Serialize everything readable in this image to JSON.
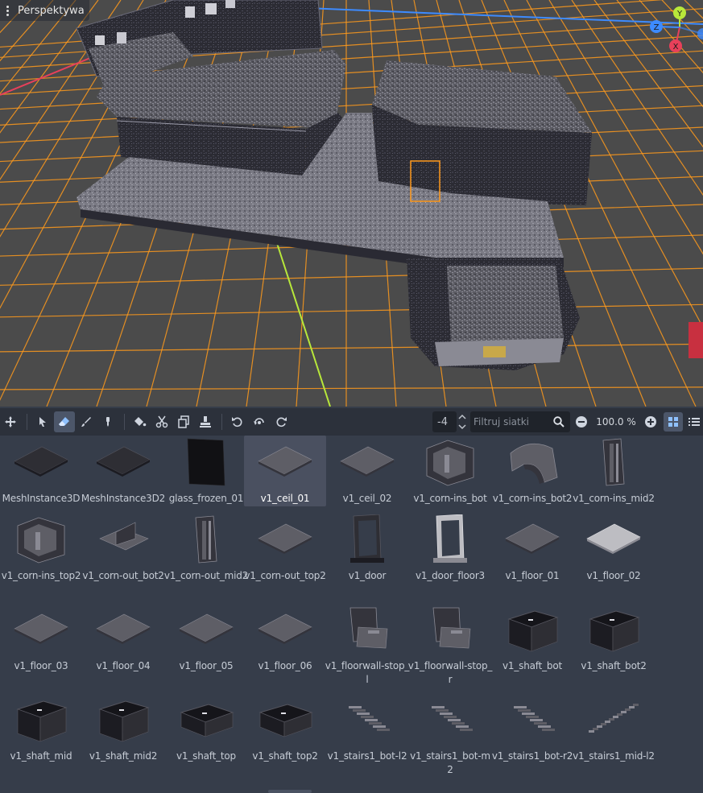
{
  "viewport": {
    "mode_label": "Perspektywa",
    "gizmo": {
      "y_label": "Y",
      "z_label": "Z",
      "x_label": "X"
    },
    "colors": {
      "grid": "#ff9a1c",
      "x_axis": "#e8405a",
      "z_axis": "#3d8bff",
      "y_axis": "#b8e83a"
    }
  },
  "toolbar": {
    "icons": [
      "transform-icon",
      "select-icon",
      "erase-icon",
      "paint-icon",
      "pick-icon",
      "fill-icon",
      "cut-icon",
      "duplicate-icon",
      "place-icon",
      "rotate-left-icon",
      "rotate-icon",
      "rotate-right-icon"
    ],
    "floor_value": "-4",
    "filter_placeholder": "Filtruj siatki",
    "zoom_value": "100.0 %"
  },
  "meshes": [
    {
      "name": "MeshInstance3D",
      "shape": "plate",
      "tone": "dark"
    },
    {
      "name": "MeshInstance3D2",
      "shape": "plate",
      "tone": "dark"
    },
    {
      "name": "glass_frozen_01",
      "shape": "panel",
      "tone": "black"
    },
    {
      "name": "v1_ceil_01",
      "shape": "plate",
      "tone": "mid",
      "selected": true
    },
    {
      "name": "v1_ceil_02",
      "shape": "plate",
      "tone": "mid"
    },
    {
      "name": "v1_corn-ins_bot",
      "shape": "corner",
      "tone": "mid"
    },
    {
      "name": "v1_corn-ins_bot2",
      "shape": "arch",
      "tone": "mid"
    },
    {
      "name": "v1_corn-ins_mid2",
      "shape": "pillar",
      "tone": "mid"
    },
    {
      "name": "v1_corn-ins_top2",
      "shape": "corner",
      "tone": "mid"
    },
    {
      "name": "v1_corn-out_bot2",
      "shape": "ledge",
      "tone": "mid"
    },
    {
      "name": "v1_corn-out_mid2",
      "shape": "pillar",
      "tone": "mid"
    },
    {
      "name": "v1_corn-out_top2",
      "shape": "plate",
      "tone": "mid"
    },
    {
      "name": "v1_door",
      "shape": "door",
      "tone": "dark"
    },
    {
      "name": "v1_door_floor3",
      "shape": "door",
      "tone": "light"
    },
    {
      "name": "v1_floor_01",
      "shape": "plate",
      "tone": "mid"
    },
    {
      "name": "v1_floor_02",
      "shape": "plate",
      "tone": "light"
    },
    {
      "name": "v1_floor_03",
      "shape": "plate",
      "tone": "mid"
    },
    {
      "name": "v1_floor_04",
      "shape": "plate",
      "tone": "mid"
    },
    {
      "name": "v1_floor_05",
      "shape": "plate",
      "tone": "mid"
    },
    {
      "name": "v1_floor_06",
      "shape": "plate",
      "tone": "mid"
    },
    {
      "name": "v1_floorwall-stop_l",
      "shape": "wallstop",
      "tone": "mid"
    },
    {
      "name": "v1_floorwall-stop_r",
      "shape": "wallstop",
      "tone": "mid"
    },
    {
      "name": "v1_shaft_bot",
      "shape": "box",
      "tone": "dark"
    },
    {
      "name": "v1_shaft_bot2",
      "shape": "box",
      "tone": "dark"
    },
    {
      "name": "v1_shaft_mid",
      "shape": "box",
      "tone": "dark"
    },
    {
      "name": "v1_shaft_mid2",
      "shape": "box",
      "tone": "dark"
    },
    {
      "name": "v1_shaft_top",
      "shape": "lowbox",
      "tone": "dark"
    },
    {
      "name": "v1_shaft_top2",
      "shape": "lowbox",
      "tone": "dark"
    },
    {
      "name": "v1_stairs1_bot-l2",
      "shape": "stairs",
      "tone": "mid"
    },
    {
      "name": "v1_stairs1_bot-m2",
      "shape": "stairs",
      "tone": "mid"
    },
    {
      "name": "v1_stairs1_bot-r2",
      "shape": "stairs",
      "tone": "mid"
    },
    {
      "name": "v1_stairs1_mid-l2",
      "shape": "stairsline",
      "tone": "mid"
    }
  ]
}
